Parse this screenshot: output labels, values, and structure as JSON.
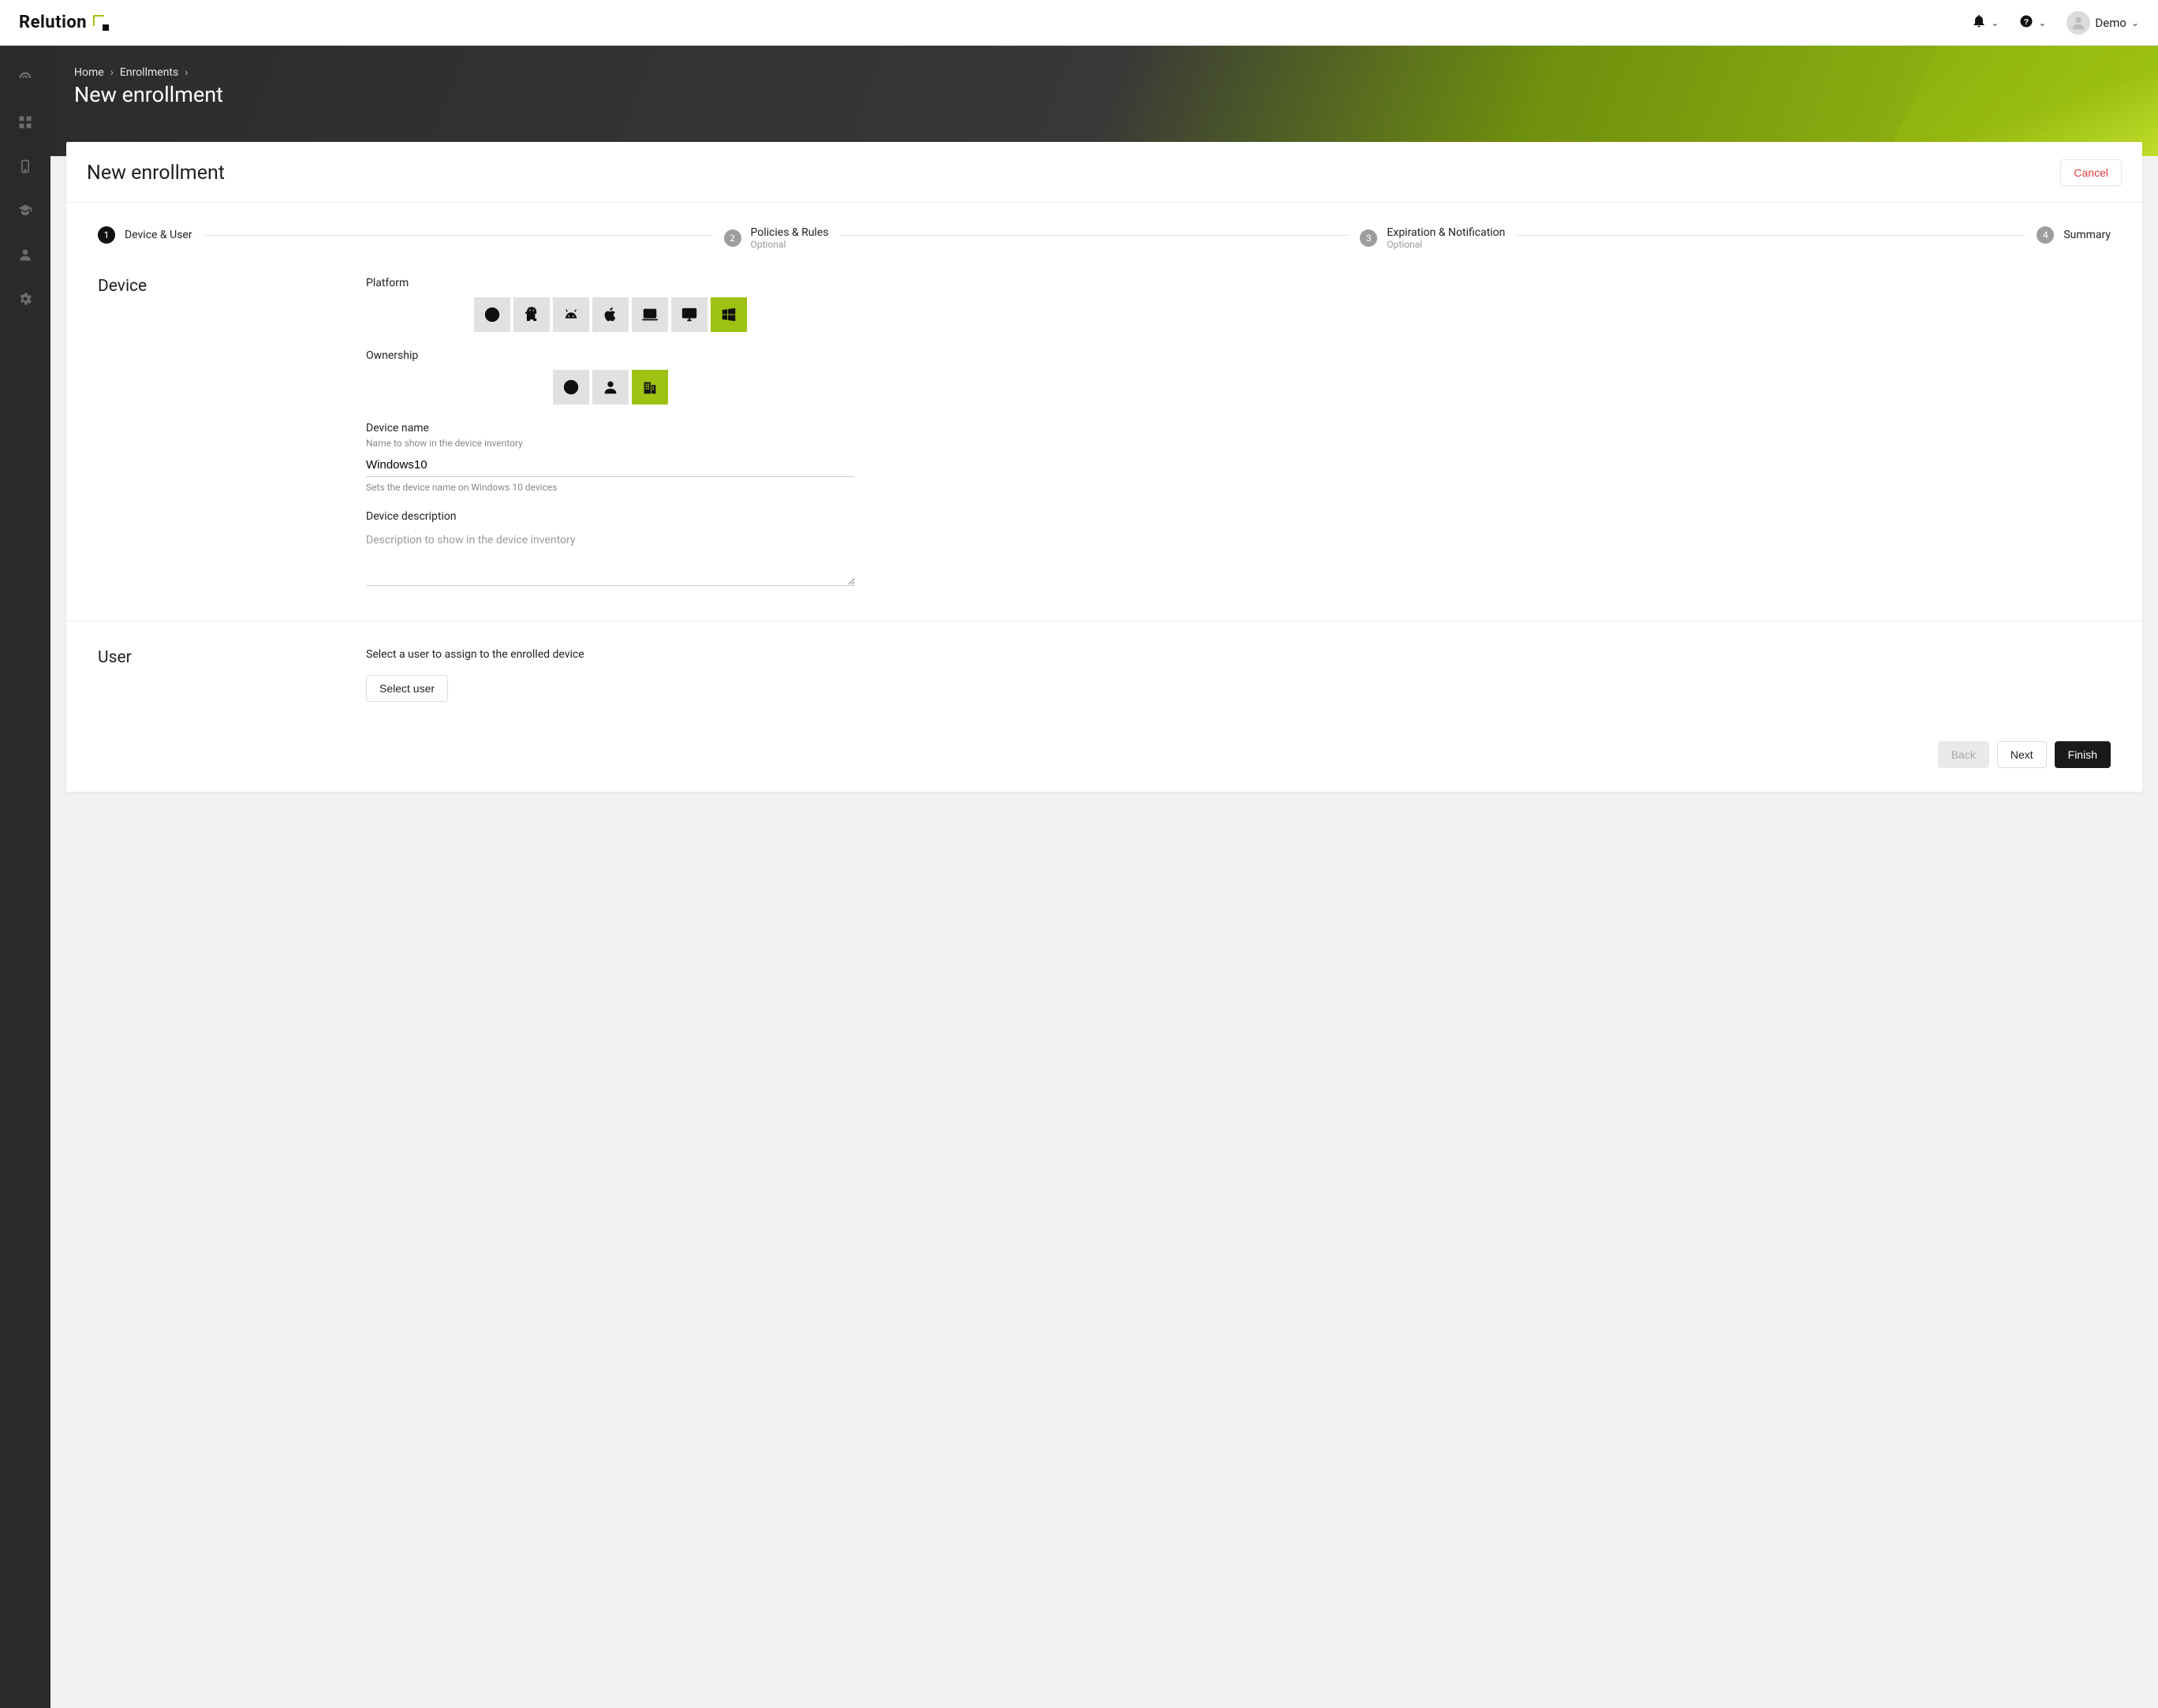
{
  "brand": {
    "name": "Relution"
  },
  "topbar": {
    "user_name": "Demo"
  },
  "breadcrumb": {
    "items": [
      "Home",
      "Enrollments"
    ],
    "title": "New enrollment"
  },
  "card": {
    "title": "New enrollment",
    "cancel_label": "Cancel"
  },
  "stepper": {
    "steps": [
      {
        "num": "1",
        "label": "Device & User",
        "sub": "",
        "active": true
      },
      {
        "num": "2",
        "label": "Policies & Rules",
        "sub": "Optional",
        "active": false
      },
      {
        "num": "3",
        "label": "Expiration & Notification",
        "sub": "Optional",
        "active": false
      },
      {
        "num": "4",
        "label": "Summary",
        "sub": "",
        "active": false
      }
    ]
  },
  "device": {
    "section_title": "Device",
    "platform_label": "Platform",
    "platform_options": [
      {
        "id": "unknown",
        "icon": "question-icon",
        "selected": false
      },
      {
        "id": "android",
        "icon": "android-icon",
        "selected": false
      },
      {
        "id": "android-ent",
        "icon": "android-enterprise-icon",
        "selected": false
      },
      {
        "id": "apple",
        "icon": "apple-icon",
        "selected": false
      },
      {
        "id": "laptop",
        "icon": "laptop-icon",
        "selected": false
      },
      {
        "id": "desktop",
        "icon": "desktop-icon",
        "selected": false
      },
      {
        "id": "windows",
        "icon": "windows-icon",
        "selected": true
      }
    ],
    "ownership_label": "Ownership",
    "ownership_options": [
      {
        "id": "unknown",
        "icon": "question-icon",
        "selected": false
      },
      {
        "id": "personal",
        "icon": "person-icon",
        "selected": false
      },
      {
        "id": "corporate",
        "icon": "building-icon",
        "selected": true
      }
    ],
    "name_label": "Device name",
    "name_sub": "Name to show in the device inventory",
    "name_value": "Windows10",
    "name_help": "Sets the device name on Windows 10 devices",
    "desc_label": "Device description",
    "desc_placeholder": "Description to show in the device inventory"
  },
  "user": {
    "section_title": "User",
    "hint": "Select a user to assign to the enrolled device",
    "select_button": "Select user"
  },
  "footer": {
    "back": "Back",
    "next": "Next",
    "finish": "Finish"
  }
}
